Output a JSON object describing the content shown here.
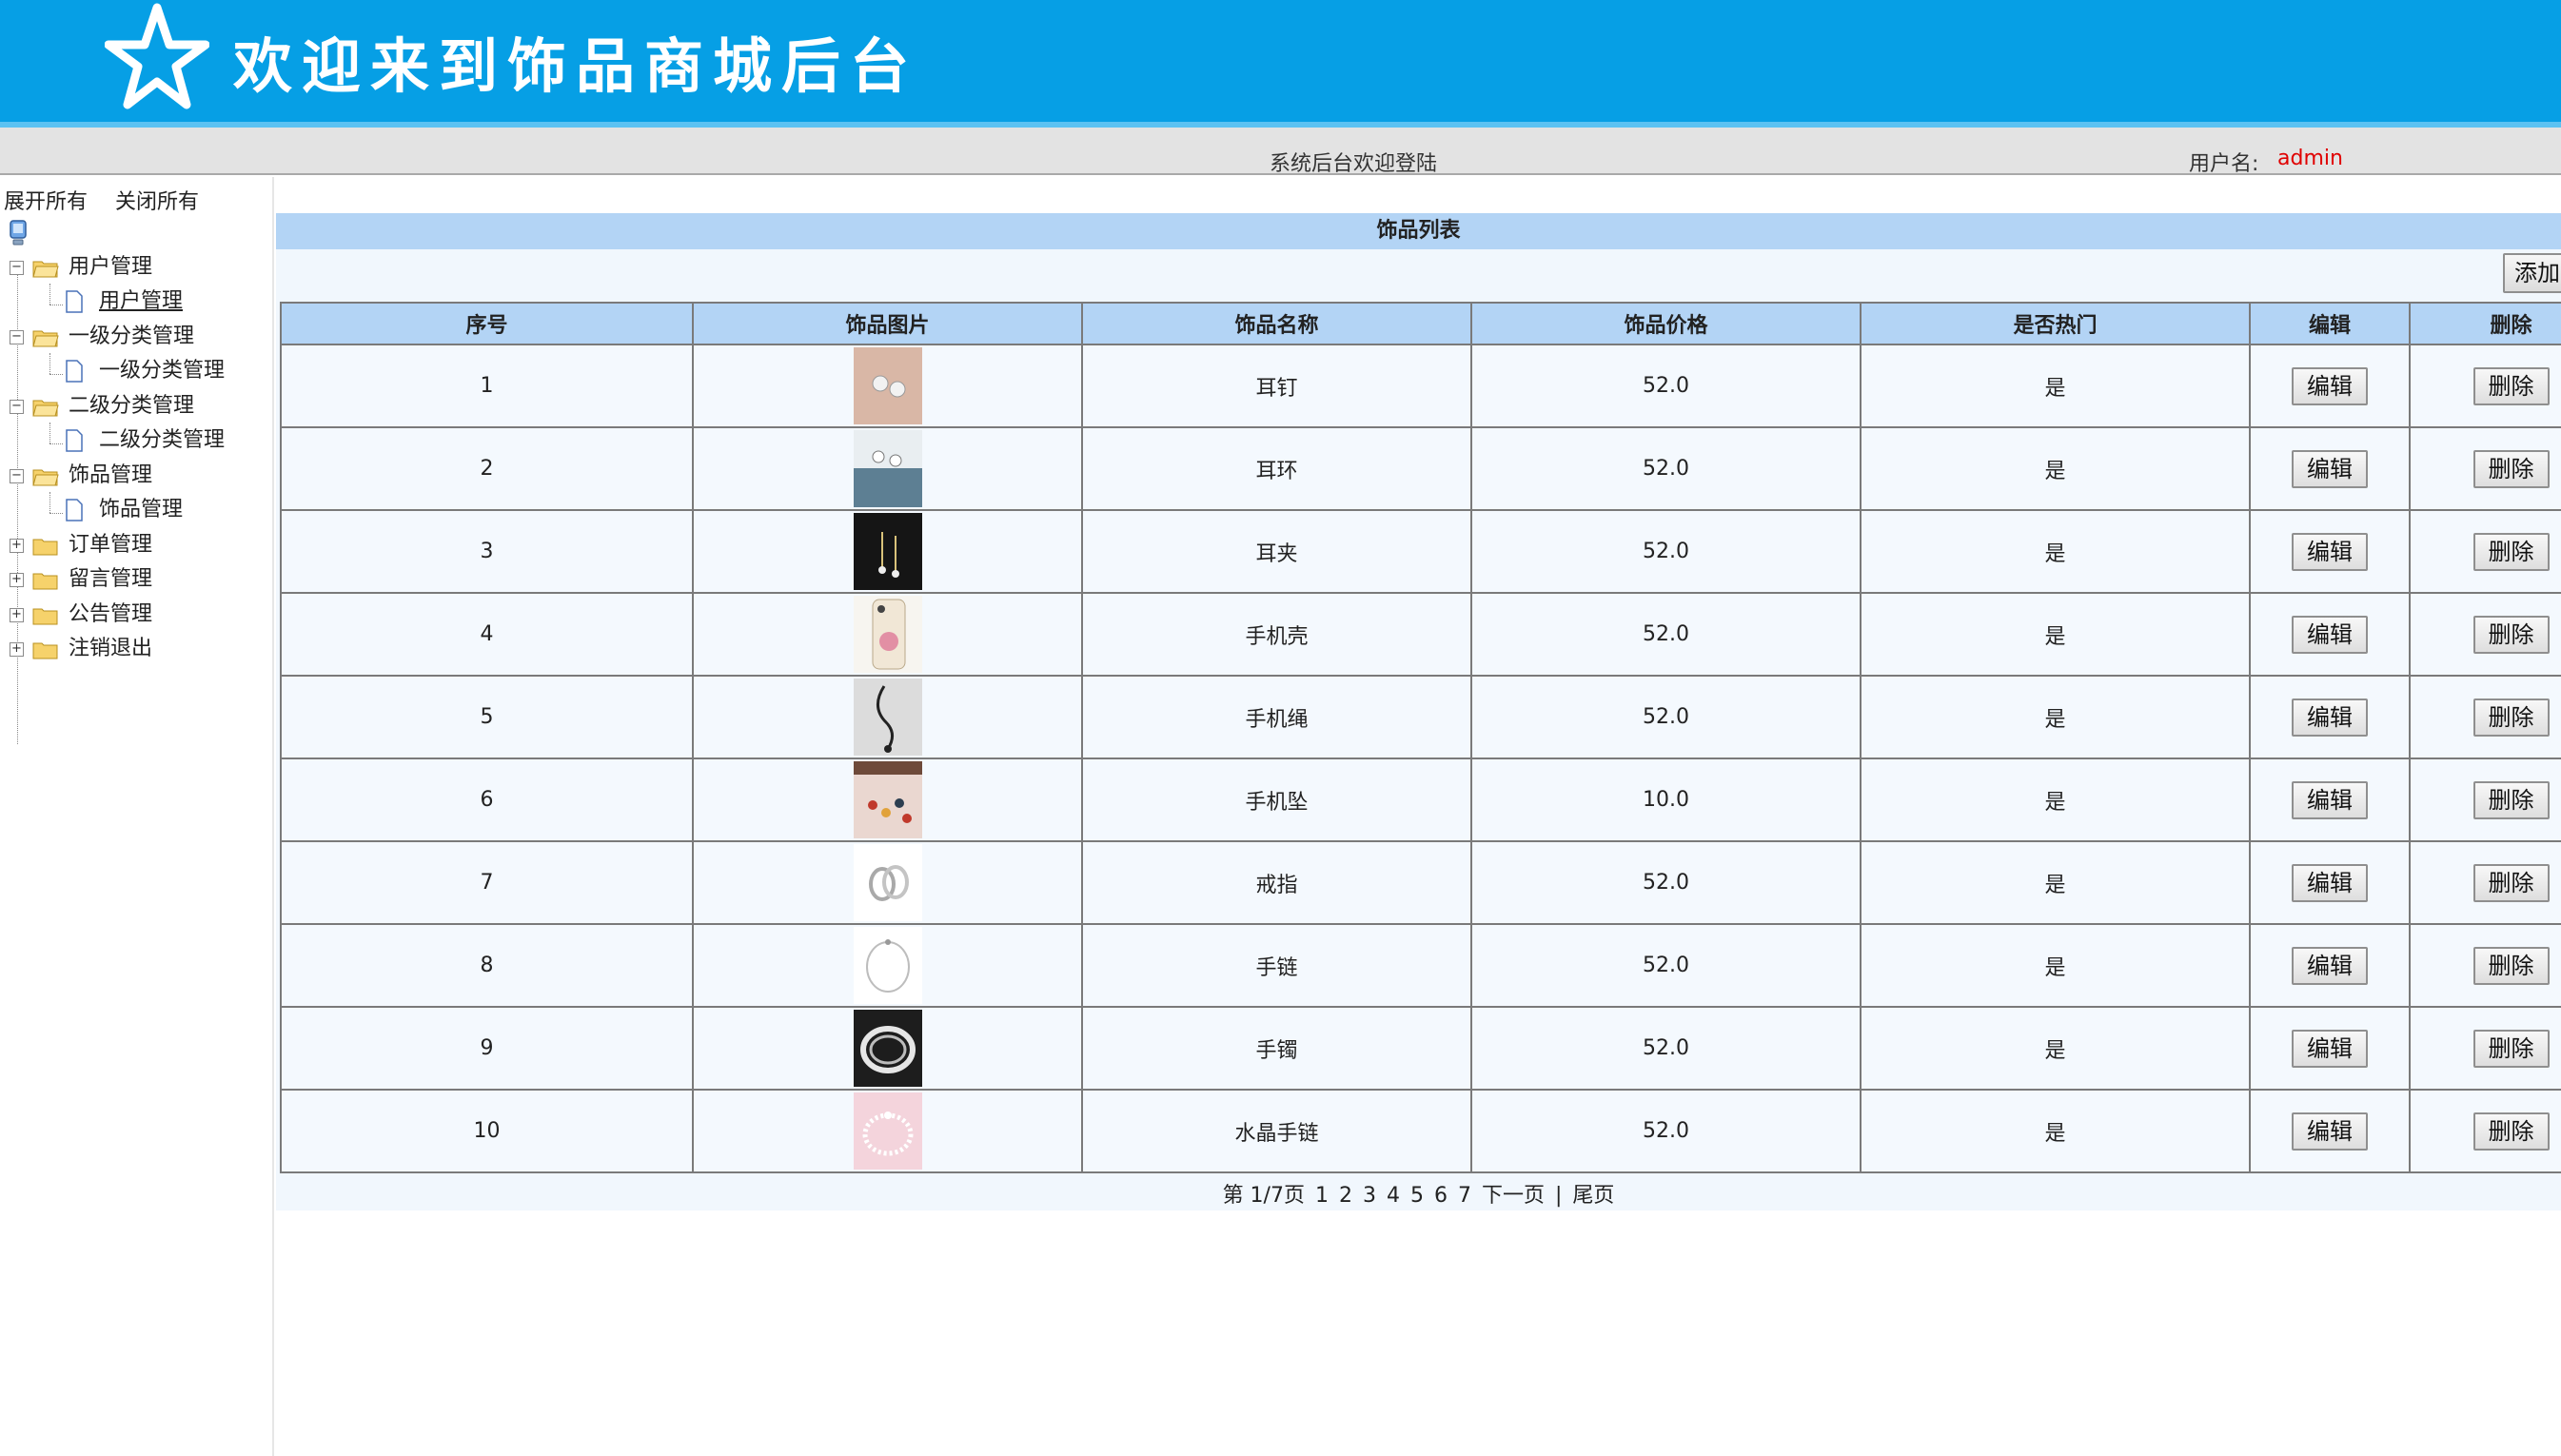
{
  "header": {
    "title": "欢迎来到饰品商城后台"
  },
  "status": {
    "welcome": "系统后台欢迎登陆",
    "user_label": "用户名:",
    "user_value": "admin"
  },
  "sidebar": {
    "expand_all": "展开所有",
    "collapse_all": "关闭所有",
    "groups": [
      {
        "label": "用户管理",
        "child": "用户管理"
      },
      {
        "label": "一级分类管理",
        "child": "一级分类管理"
      },
      {
        "label": "二级分类管理",
        "child": "二级分类管理"
      },
      {
        "label": "饰品管理",
        "child": "饰品管理"
      },
      {
        "label": "订单管理"
      },
      {
        "label": "留言管理"
      },
      {
        "label": "公告管理"
      },
      {
        "label": "注销退出"
      }
    ]
  },
  "main": {
    "panel_title": "饰品列表",
    "add_label": "添加",
    "columns": [
      "序号",
      "饰品图片",
      "饰品名称",
      "饰品价格",
      "是否热门",
      "编辑",
      "删除"
    ],
    "edit_label": "编辑",
    "delete_label": "删除",
    "rows": [
      {
        "id": "1",
        "name": "耳钉",
        "price": "52.0",
        "hot": "是",
        "image": "earring-studs-image"
      },
      {
        "id": "2",
        "name": "耳环",
        "price": "52.0",
        "hot": "是",
        "image": "earrings-image"
      },
      {
        "id": "3",
        "name": "耳夹",
        "price": "52.0",
        "hot": "是",
        "image": "ear-clip-image"
      },
      {
        "id": "4",
        "name": "手机壳",
        "price": "52.0",
        "hot": "是",
        "image": "phone-case-image"
      },
      {
        "id": "5",
        "name": "手机绳",
        "price": "52.0",
        "hot": "是",
        "image": "phone-strap-image"
      },
      {
        "id": "6",
        "name": "手机坠",
        "price": "10.0",
        "hot": "是",
        "image": "phone-charm-image"
      },
      {
        "id": "7",
        "name": "戒指",
        "price": "52.0",
        "hot": "是",
        "image": "ring-image"
      },
      {
        "id": "8",
        "name": "手链",
        "price": "52.0",
        "hot": "是",
        "image": "bracelet-image"
      },
      {
        "id": "9",
        "name": "手镯",
        "price": "52.0",
        "hot": "是",
        "image": "bangle-image"
      },
      {
        "id": "10",
        "name": "水晶手链",
        "price": "52.0",
        "hot": "是",
        "image": "crystal-bracelet-image"
      }
    ],
    "pager": {
      "info": "第 1/7页",
      "pages": [
        "1",
        "2",
        "3",
        "4",
        "5",
        "6",
        "7"
      ],
      "next": "下一页",
      "separator": "|",
      "last": "尾页"
    }
  },
  "colors": {
    "banner": "#069fe5",
    "table_header": "#b3d4f5",
    "username": "#e00000"
  }
}
